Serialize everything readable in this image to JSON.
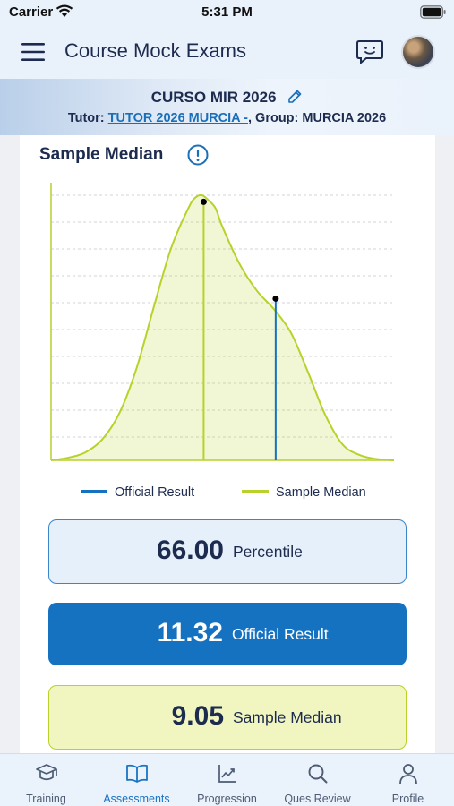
{
  "status_bar": {
    "carrier": "Carrier",
    "time": "5:31 PM"
  },
  "nav": {
    "title": "Course Mock Exams"
  },
  "course": {
    "title": "CURSO MIR 2026",
    "tutor_prefix": "Tutor: ",
    "tutor_link": "TUTOR 2026 MURCIA -",
    "group_text": ", Group: MURCIA 2026"
  },
  "card": {
    "title": "Sample Median"
  },
  "chart_data": {
    "type": "area",
    "title": "Sample Median",
    "xlabel": "",
    "ylabel": "",
    "grid": true,
    "legend_position": "bottom",
    "series": [
      {
        "name": "Sample Median",
        "color": "#b9d12a",
        "x": [
          0,
          5,
          10,
          15,
          20,
          25,
          30,
          35,
          40,
          42,
          44,
          46,
          48,
          50,
          55,
          60,
          65,
          70,
          75,
          80,
          85,
          90,
          95,
          100
        ],
        "y": [
          0,
          0.01,
          0.03,
          0.08,
          0.18,
          0.35,
          0.58,
          0.8,
          0.95,
          0.99,
          1.0,
          0.98,
          0.95,
          0.88,
          0.74,
          0.64,
          0.57,
          0.48,
          0.33,
          0.17,
          0.06,
          0.02,
          0.005,
          0
        ]
      }
    ],
    "markers": [
      {
        "name": "Sample Median",
        "x": 44.5,
        "y": 0.975,
        "color": "#b9d12a"
      },
      {
        "name": "Official Result",
        "x": 65.5,
        "y": 0.61,
        "color": "#1572c1"
      }
    ],
    "legend": [
      {
        "label": "Official Result",
        "color": "#1572c1"
      },
      {
        "label": "Sample Median",
        "color": "#b9d12a"
      }
    ]
  },
  "metrics": {
    "percentile": {
      "value": "66.00",
      "label": "Percentile"
    },
    "official": {
      "value": "11.32",
      "label": "Official Result"
    },
    "median": {
      "value": "9.05",
      "label": "Sample Median"
    }
  },
  "tabs": [
    {
      "label": "Training",
      "icon": "graduation-cap-icon",
      "active": false
    },
    {
      "label": "Assessments",
      "icon": "book-open-icon",
      "active": true
    },
    {
      "label": "Progression",
      "icon": "trend-chart-icon",
      "active": false
    },
    {
      "label": "Ques Review",
      "icon": "search-icon",
      "active": false
    },
    {
      "label": "Profile",
      "icon": "person-icon",
      "active": false
    }
  ],
  "colors": {
    "accent": "#1572c1",
    "median": "#b9d12a",
    "text": "#1d2b4f"
  }
}
